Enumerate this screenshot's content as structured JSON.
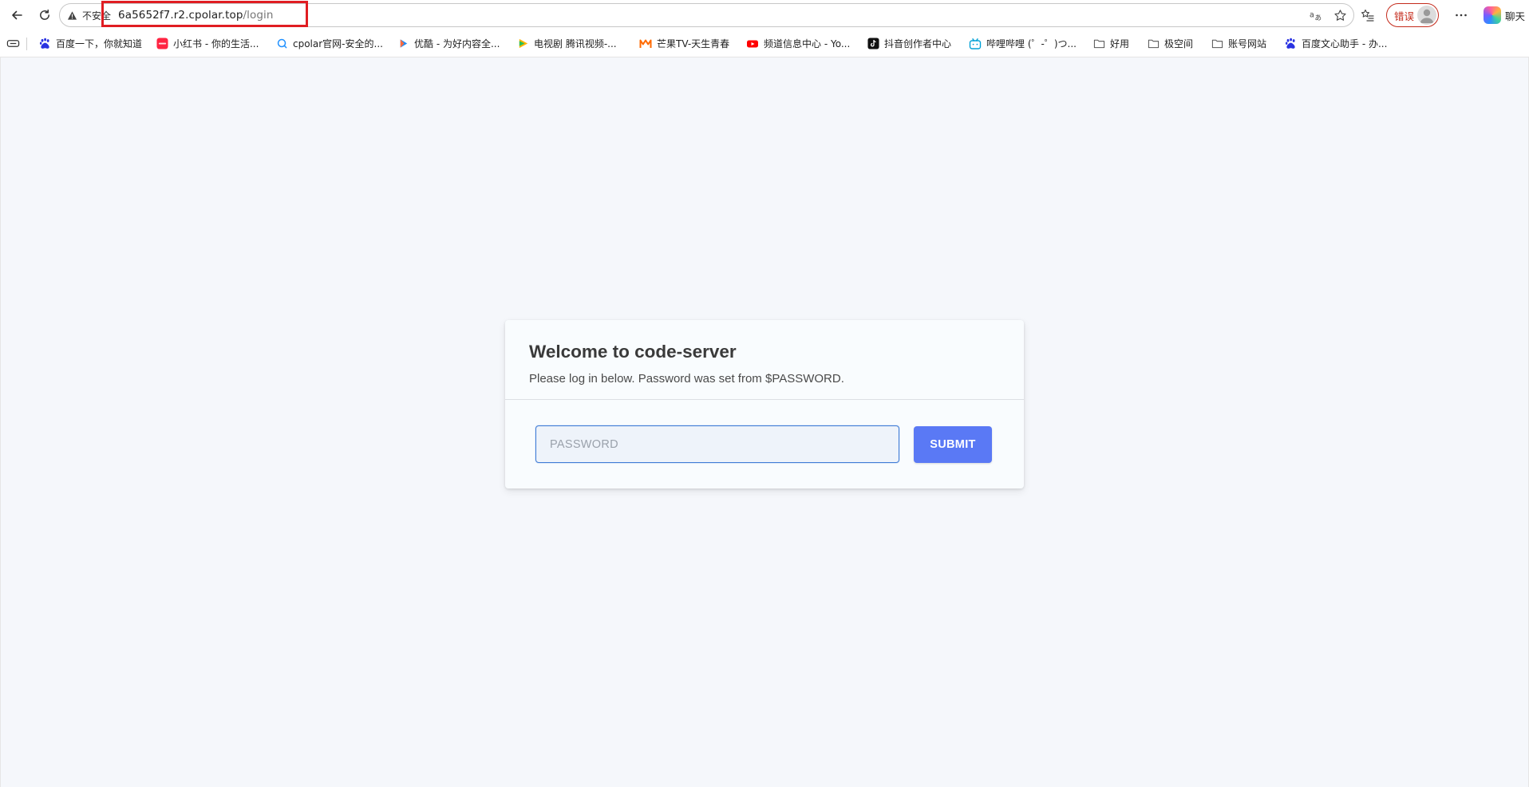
{
  "browser": {
    "security_label": "不安全",
    "url_host": "6a5652f7.r2.cpolar.top",
    "url_path": "/login",
    "error_label": "错误",
    "copilot_label": "聊天"
  },
  "bookmarks": [
    {
      "label": "百度一下，你就知道",
      "icon": "baidu-icon",
      "color": "#2932e1"
    },
    {
      "label": "小红书 - 你的生活...",
      "icon": "xiaohongshu-icon",
      "color": "#ff2442"
    },
    {
      "label": "cpolar官网-安全的...",
      "icon": "cpolar-icon",
      "color": "#1e90ff"
    },
    {
      "label": "优酷 - 为好内容全...",
      "icon": "youku-icon",
      "color": "#1f8bf5"
    },
    {
      "label": "电视剧 腾讯视频-...",
      "icon": "tencent-video-icon",
      "color": "#24c15e"
    },
    {
      "label": "芒果TV-天生青春",
      "icon": "mango-tv-icon",
      "color": "#ff6a00"
    },
    {
      "label": "频道信息中心 - Yo...",
      "icon": "youtube-icon",
      "color": "#ff0000"
    },
    {
      "label": "抖音创作者中心",
      "icon": "douyin-icon",
      "color": "#111111"
    },
    {
      "label": "哔哩哔哩 (゜-゜)つ...",
      "icon": "bilibili-icon",
      "color": "#00a1d6"
    },
    {
      "label": "好用",
      "icon": "folder-icon",
      "color": "#555555"
    },
    {
      "label": "极空间",
      "icon": "folder-icon",
      "color": "#555555"
    },
    {
      "label": "账号网站",
      "icon": "folder-icon",
      "color": "#555555"
    },
    {
      "label": "百度文心助手 - 办...",
      "icon": "baidu-icon",
      "color": "#2932e1"
    }
  ],
  "login": {
    "title": "Welcome to code-server",
    "subtitle": "Please log in below. Password was set from $PASSWORD.",
    "password_placeholder": "PASSWORD",
    "submit_label": "SUBMIT"
  },
  "colors": {
    "accent": "#5a79f5",
    "focus_border": "#3f7cd6",
    "highlight_box": "#e01d22",
    "error": "#c42b1c"
  }
}
